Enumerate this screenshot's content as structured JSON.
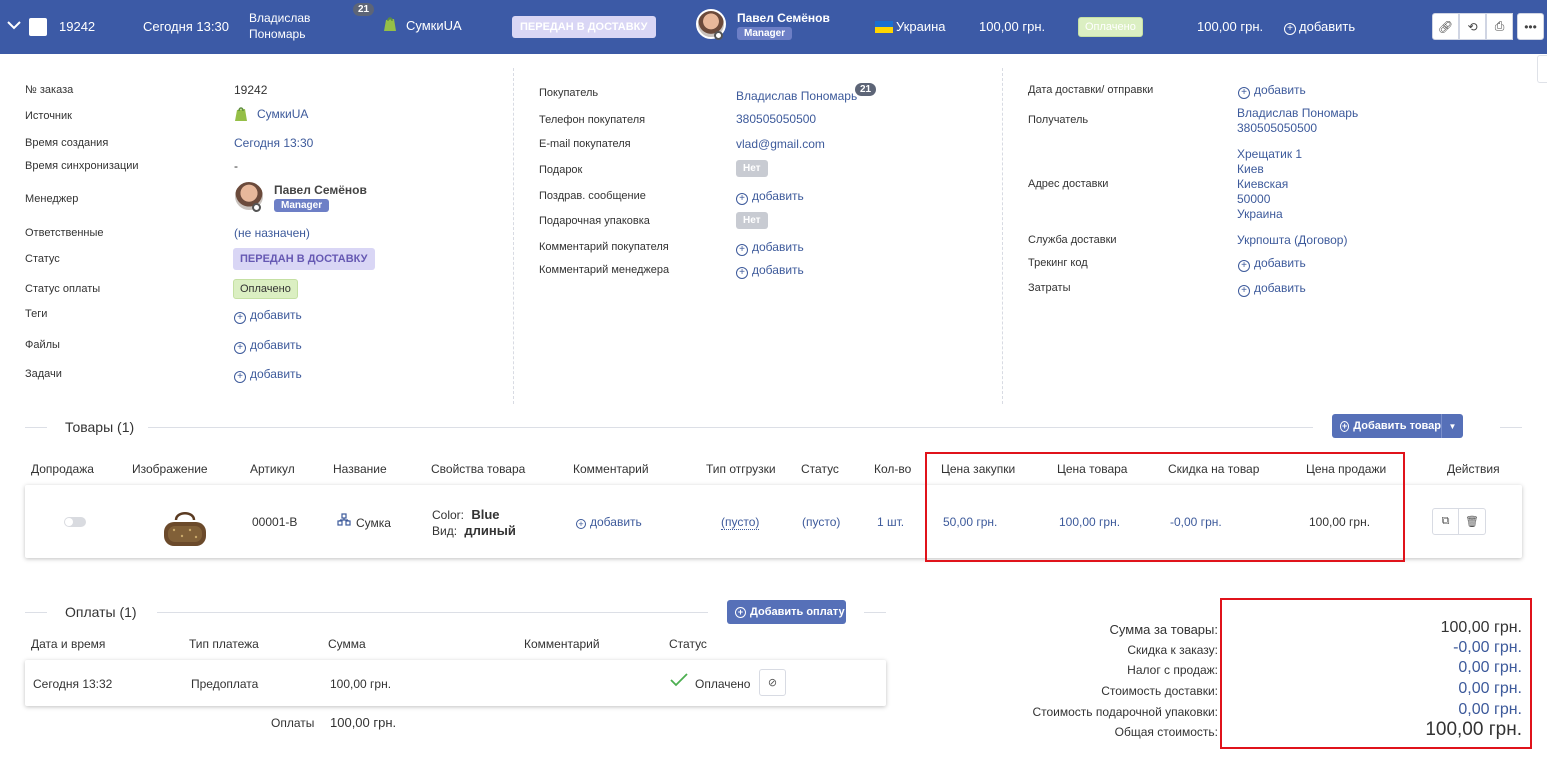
{
  "topbar": {
    "order_id": "19242",
    "created": "Сегодня 13:30",
    "customer_line1": "Владислав",
    "customer_line2": "Пономарь",
    "customer_orders": "21",
    "source": "СумкиUA",
    "status": "ПЕРЕДАН В ДОСТАВКУ",
    "manager_name": "Павел Семёнов",
    "manager_role": "Manager",
    "country": "Украина",
    "total": "100,00 грн.",
    "payment_status": "Оплачено",
    "paid_amount": "100,00 грн.",
    "add_label": "добавить"
  },
  "order_info": {
    "order_no_label": "№ заказа",
    "order_no": "19242",
    "source_label": "Источник",
    "source": "СумкиUA",
    "created_label": "Время создания",
    "created": "Сегодня 13:30",
    "sync_label": "Время синхронизации",
    "sync": "-",
    "manager_label": "Менеджер",
    "manager_name": "Павел Семёнов",
    "manager_role": "Manager",
    "responsible_label": "Ответственные",
    "responsible": "(не назначен)",
    "status_label": "Статус",
    "status": "ПЕРЕДАН В ДОСТАВКУ",
    "payment_status_label": "Статус оплаты",
    "payment_status": "Оплачено",
    "tags_label": "Теги",
    "files_label": "Файлы",
    "tasks_label": "Задачи",
    "add": "добавить"
  },
  "buyer_info": {
    "buyer_label": "Покупатель",
    "buyer": "Владислав Пономарь",
    "buyer_orders": "21",
    "phone_label": "Телефон покупателя",
    "phone": "380505050500",
    "email_label": "E-mail покупателя",
    "email": "vlad@gmail.com",
    "gift_label": "Подарок",
    "gift": "Нет",
    "greeting_label": "Поздрав. сообщение",
    "gift_wrap_label": "Подарочная упаковка",
    "gift_wrap": "Нет",
    "buyer_comment_label": "Комментарий покупателя",
    "manager_comment_label": "Комментарий менеджера",
    "add": "добавить"
  },
  "delivery_info": {
    "date_label": "Дата доставки/ отправки",
    "recipient_label": "Получатель",
    "recipient_name": "Владислав Пономарь",
    "recipient_phone": "380505050500",
    "address_label": "Адрес доставки",
    "address": [
      "Хрещатик 1",
      "Киев",
      "Киевская",
      "50000",
      "Украина"
    ],
    "service_label": "Служба доставки",
    "service": "Укрпошта (Договор)",
    "tracking_label": "Трекинг код",
    "costs_label": "Затраты",
    "add": "добавить"
  },
  "products": {
    "title": "Товары (1)",
    "add_button": "Добавить товар",
    "headers": [
      "Допродажа",
      "Изображение",
      "Артикул",
      "Название",
      "Свойства товара",
      "Комментарий",
      "Тип отгрузки",
      "Статус",
      "Кол-во",
      "Цена закупки",
      "Цена товара",
      "Скидка на товар",
      "Цена продажи",
      "Действия"
    ],
    "row": {
      "sku": "00001-B",
      "name": "Сумка",
      "prop1_key": "Color:",
      "prop1_val": "Blue",
      "prop2_key": "Вид:",
      "prop2_val": "длиный",
      "comment": "добавить",
      "shipment": "(пусто)",
      "status": "(пусто)",
      "qty": "1 шт.",
      "purchase_price": "50,00 грн.",
      "price": "100,00 грн.",
      "discount": "-0,00 грн.",
      "sale_price": "100,00 грн."
    }
  },
  "payments": {
    "title": "Оплаты (1)",
    "add_button": "Добавить оплату",
    "headers": [
      "Дата и время",
      "Тип платежа",
      "Сумма",
      "Комментарий",
      "Статус"
    ],
    "row": {
      "date": "Сегодня 13:32",
      "type": "Предоплата",
      "amount": "100,00 грн.",
      "status": "Оплачено"
    },
    "total_label": "Оплаты",
    "total": "100,00 грн."
  },
  "summary": {
    "items_label": "Сумма за товары:",
    "items": "100,00 грн.",
    "discount_label": "Скидка к заказу:",
    "discount": "-0,00 грн.",
    "tax_label": "Налог с продаж:",
    "tax": "0,00 грн.",
    "delivery_label": "Стоимость доставки:",
    "delivery": "0,00 грн.",
    "wrap_label": "Стоимость подарочной упаковки:",
    "wrap": "0,00 грн.",
    "total_label": "Общая стоимость:",
    "total": "100,00 грн."
  },
  "colors": {
    "header_bg": "#3c5aa6",
    "link": "#3d5a9b",
    "highlight": "#e0131b",
    "button": "#5670b8"
  }
}
